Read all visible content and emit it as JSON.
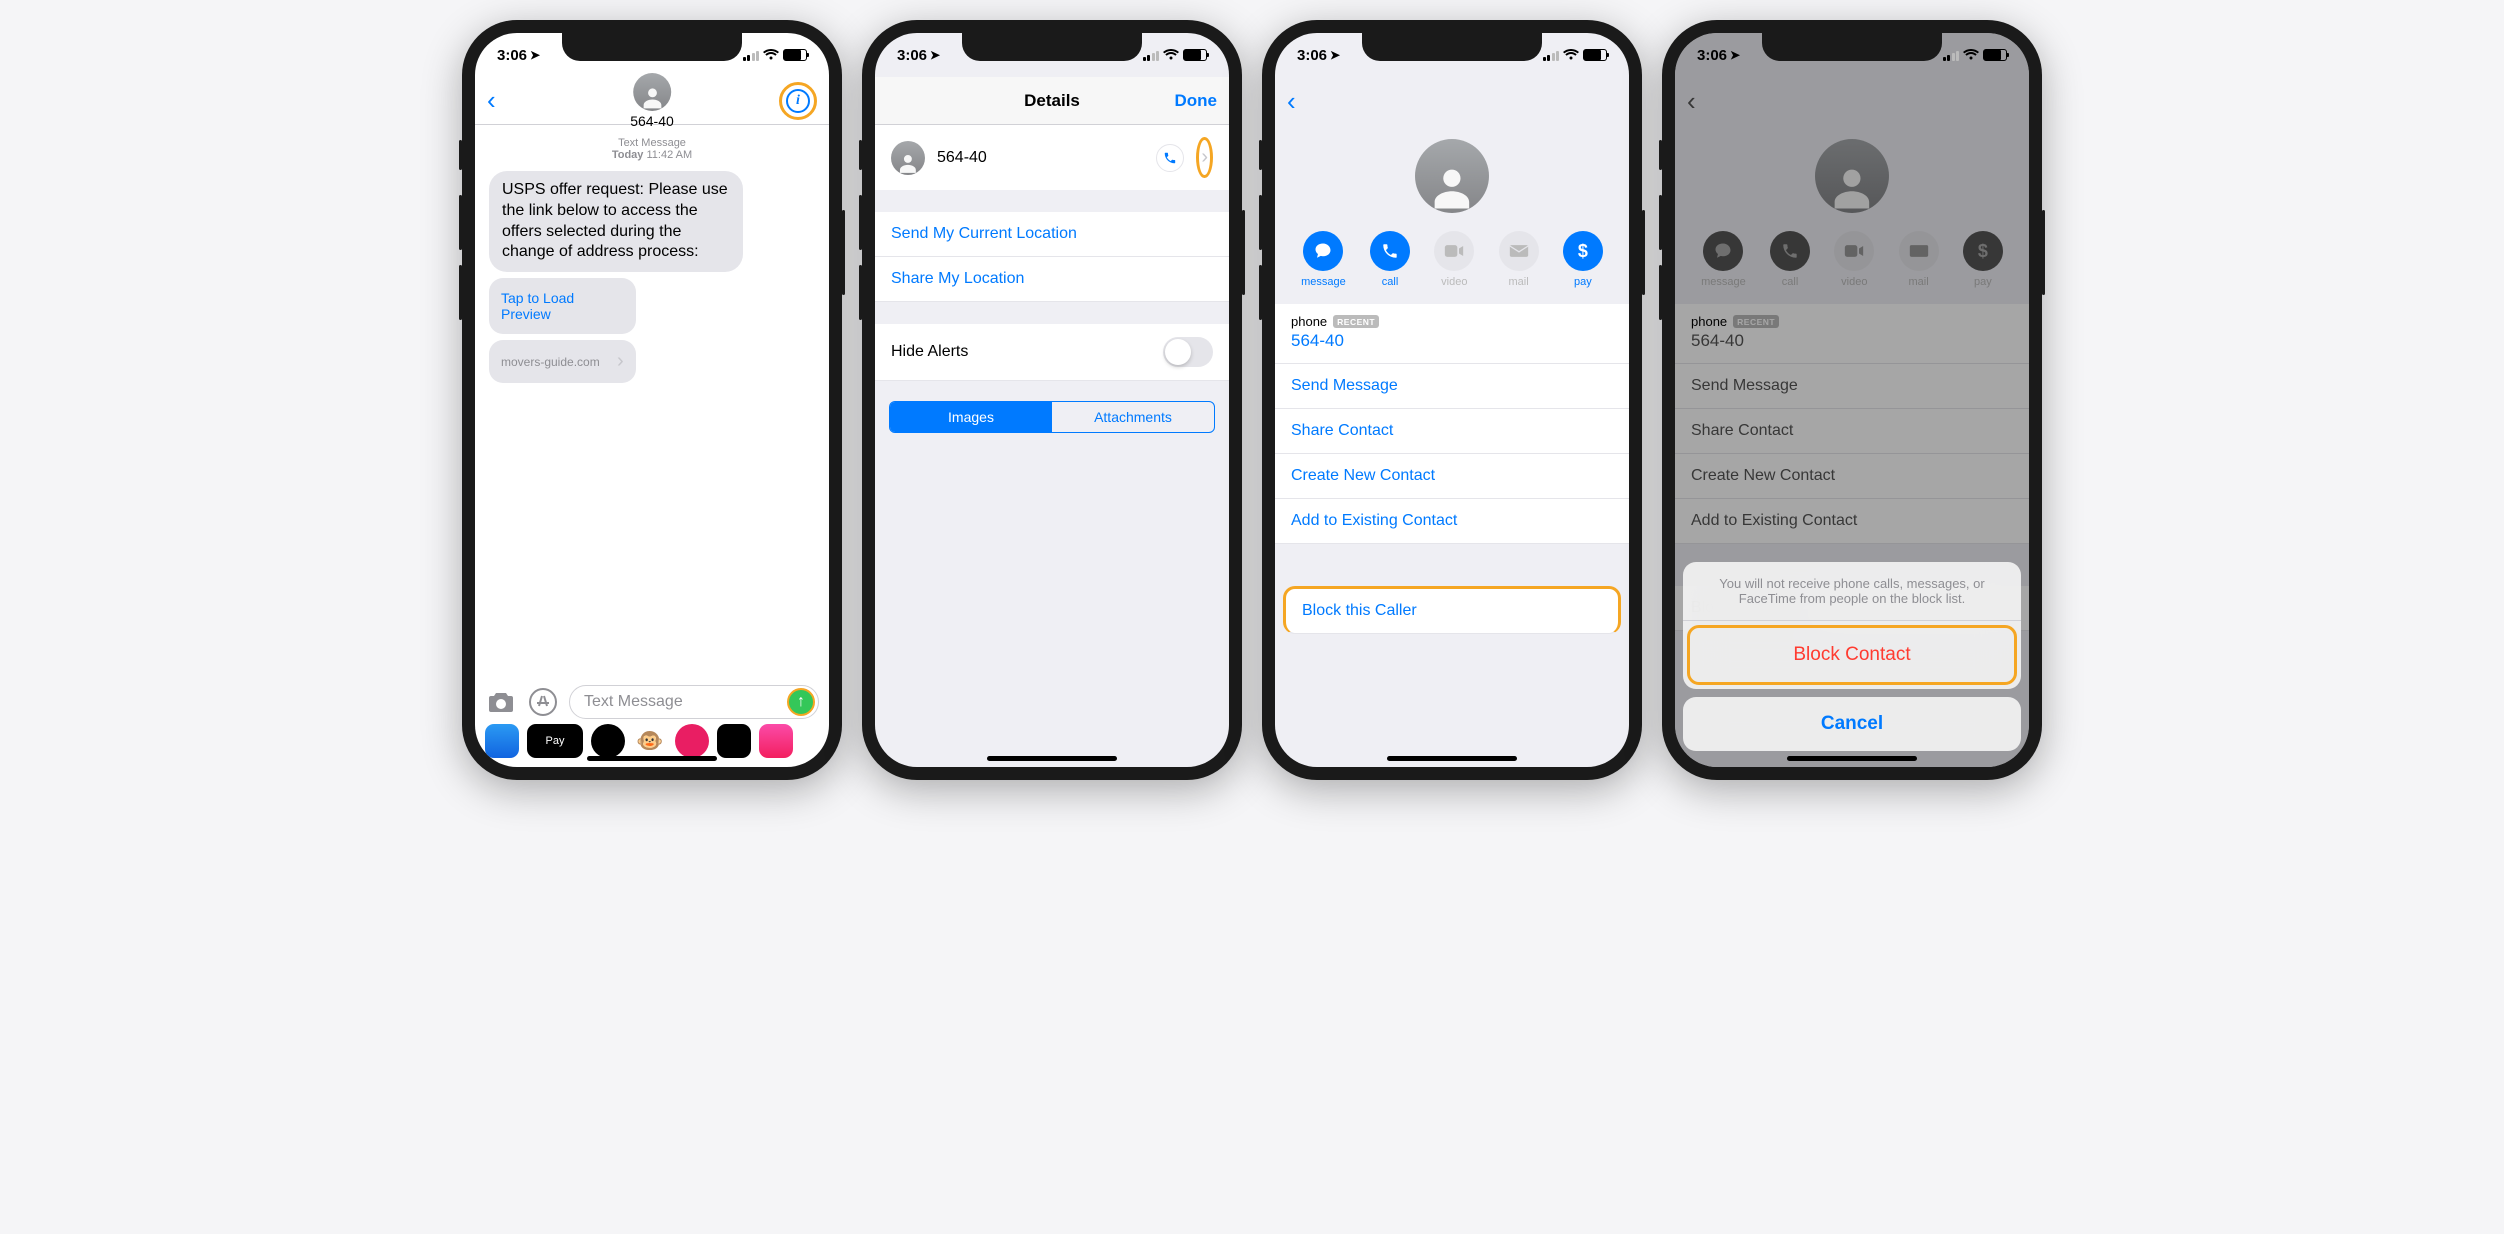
{
  "status": {
    "time": "3:06"
  },
  "screen1": {
    "contact": "564-40",
    "meta_label": "Text Message",
    "meta_day": "Today",
    "meta_time": "11:42 AM",
    "message": "USPS offer request: Please use the link below to access the offers selected during the change of address process:",
    "preview_link": "Tap to Load Preview",
    "url": "movers-guide.com",
    "input_placeholder": "Text Message"
  },
  "screen2": {
    "title": "Details",
    "done": "Done",
    "contact": "564-40",
    "send_location": "Send My Current Location",
    "share_location": "Share My Location",
    "hide_alerts": "Hide Alerts",
    "seg_images": "Images",
    "seg_attachments": "Attachments"
  },
  "screen3": {
    "actions": {
      "message": "message",
      "call": "call",
      "video": "video",
      "mail": "mail",
      "pay": "pay"
    },
    "phone_label": "phone",
    "recent": "RECENT",
    "phone_number": "564-40",
    "send_message": "Send Message",
    "share_contact": "Share Contact",
    "create_contact": "Create New Contact",
    "add_existing": "Add to Existing Contact",
    "block": "Block this Caller"
  },
  "screen4": {
    "sheet_message": "You will not receive phone calls, messages, or FaceTime from people on the block list.",
    "block_contact": "Block Contact",
    "cancel": "Cancel"
  }
}
